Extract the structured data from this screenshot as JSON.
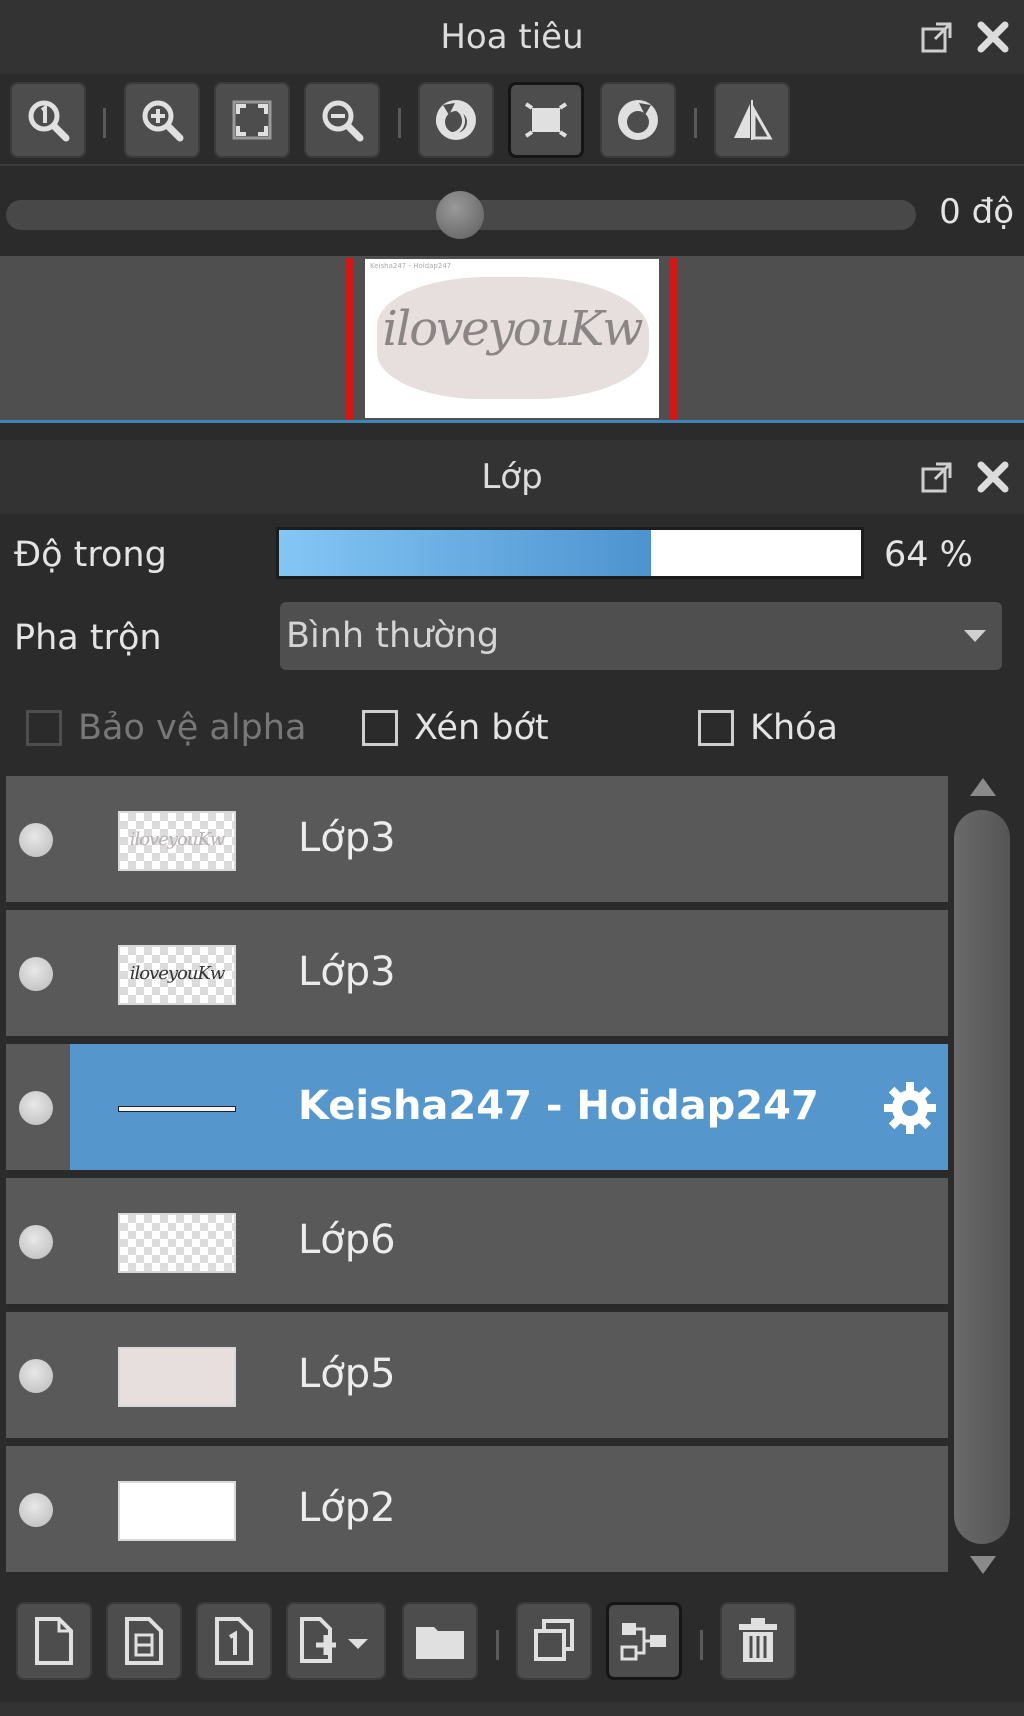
{
  "navigator": {
    "title": "Hoa tiêu",
    "rotation_value": "0 độ",
    "preview_text": "iloveyouKw",
    "preview_small_text": "Keisha247 - Hoidap247"
  },
  "layers_panel": {
    "title": "Lớp",
    "opacity_label": "Độ trong",
    "opacity_value": "64 %",
    "opacity_fraction": 0.64,
    "blend_label": "Pha trộn",
    "blend_mode": "Bình thường",
    "protect_alpha_label": "Bảo vệ alpha",
    "clip_label": "Xén bớt",
    "lock_label": "Khóa",
    "layers": [
      {
        "name": "Lớp3"
      },
      {
        "name": "Lớp3"
      },
      {
        "name": "Keisha247 - Hoidap247"
      },
      {
        "name": "Lớp6"
      },
      {
        "name": "Lớp5"
      },
      {
        "name": "Lớp2"
      }
    ],
    "thumb_text": "iloveyouKw"
  },
  "colors": {
    "selection": "#5597cc",
    "opacity_fill": "#5fa8e0",
    "preview_marker": "#d01818"
  }
}
